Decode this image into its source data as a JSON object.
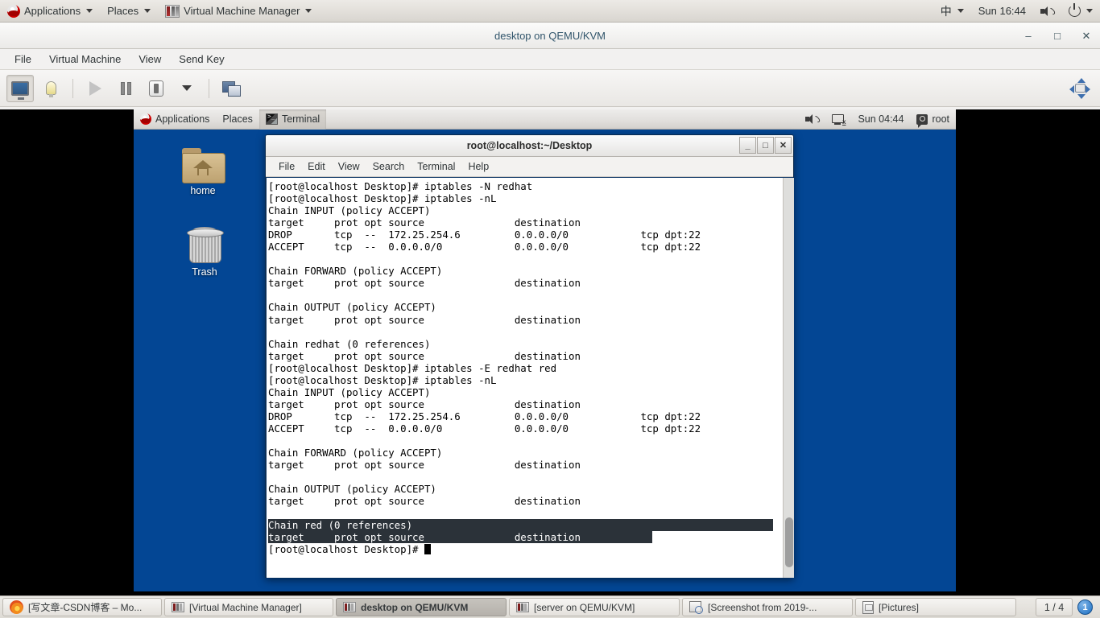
{
  "host_panel": {
    "applications": "Applications",
    "places": "Places",
    "active_app": "Virtual Machine Manager",
    "ime": "中",
    "clock": "Sun 16:44",
    "icons": {
      "redhat": "redhat-logo-icon",
      "volume": "volume-icon",
      "power": "power-icon"
    }
  },
  "vmm_window": {
    "title": "desktop on QEMU/KVM",
    "menus": [
      "File",
      "Virtual Machine",
      "View",
      "Send Key"
    ],
    "window_buttons": {
      "minimize": "–",
      "maximize": "□",
      "close": "✕"
    },
    "toolbar": [
      {
        "name": "show-console",
        "icon": "monitor-icon",
        "active": true
      },
      {
        "name": "show-details",
        "icon": "lightbulb-icon",
        "active": false
      },
      {
        "name": "run",
        "icon": "play-icon",
        "active": false
      },
      {
        "name": "pause",
        "icon": "pause-icon",
        "active": false
      },
      {
        "name": "shutdown",
        "icon": "shutdown-icon",
        "active": false
      },
      {
        "name": "shutdown-options",
        "icon": "chevron-down-icon",
        "active": false
      },
      {
        "name": "snapshots",
        "icon": "screens-icon",
        "active": false
      }
    ],
    "resize_icon": "resize-to-vm-icon"
  },
  "guest": {
    "panel": {
      "applications": "Applications",
      "places": "Places",
      "active_window": "Terminal",
      "clock": "Sun 04:44",
      "user": "root",
      "icons": {
        "redhat": "redhat-logo-icon",
        "volume": "volume-icon",
        "network": "network-disconnected-icon",
        "user": "user-icon"
      }
    },
    "desktop_icons": [
      {
        "label": "home",
        "icon": "home-folder-icon"
      },
      {
        "label": "Trash",
        "icon": "trash-icon"
      }
    ],
    "terminal": {
      "title": "root@localhost:~/Desktop",
      "menus": [
        "File",
        "Edit",
        "View",
        "Search",
        "Terminal",
        "Help"
      ],
      "window_buttons": {
        "minimize": "_",
        "maximize": "□",
        "close": "✕"
      },
      "lines": [
        {
          "text": "[root@localhost Desktop]# iptables -N redhat",
          "hl": 0
        },
        {
          "text": "[root@localhost Desktop]# iptables -nL",
          "hl": 0
        },
        {
          "text": "Chain INPUT (policy ACCEPT)",
          "hl": 0
        },
        {
          "text": "target     prot opt source               destination",
          "hl": 0
        },
        {
          "text": "DROP       tcp  --  172.25.254.6         0.0.0.0/0            tcp dpt:22",
          "hl": 0
        },
        {
          "text": "ACCEPT     tcp  --  0.0.0.0/0            0.0.0.0/0            tcp dpt:22",
          "hl": 0
        },
        {
          "text": "",
          "hl": 0
        },
        {
          "text": "Chain FORWARD (policy ACCEPT)",
          "hl": 0
        },
        {
          "text": "target     prot opt source               destination",
          "hl": 0
        },
        {
          "text": "",
          "hl": 0
        },
        {
          "text": "Chain OUTPUT (policy ACCEPT)",
          "hl": 0
        },
        {
          "text": "target     prot opt source               destination",
          "hl": 0
        },
        {
          "text": "",
          "hl": 0
        },
        {
          "text": "Chain redhat (0 references)",
          "hl": 0
        },
        {
          "text": "target     prot opt source               destination",
          "hl": 0
        },
        {
          "text": "[root@localhost Desktop]# iptables -E redhat red",
          "hl": 0
        },
        {
          "text": "[root@localhost Desktop]# iptables -nL",
          "hl": 0
        },
        {
          "text": "Chain INPUT (policy ACCEPT)",
          "hl": 0
        },
        {
          "text": "target     prot opt source               destination",
          "hl": 0
        },
        {
          "text": "DROP       tcp  --  172.25.254.6         0.0.0.0/0            tcp dpt:22",
          "hl": 0
        },
        {
          "text": "ACCEPT     tcp  --  0.0.0.0/0            0.0.0.0/0            tcp dpt:22",
          "hl": 0
        },
        {
          "text": "",
          "hl": 0
        },
        {
          "text": "Chain FORWARD (policy ACCEPT)",
          "hl": 0
        },
        {
          "text": "target     prot opt source               destination",
          "hl": 0
        },
        {
          "text": "",
          "hl": 0
        },
        {
          "text": "Chain OUTPUT (policy ACCEPT)",
          "hl": 0
        },
        {
          "text": "target     prot opt source               destination",
          "hl": 0
        },
        {
          "text": "",
          "hl": 0
        },
        {
          "text": "Chain red (0 references)",
          "hl": 2
        },
        {
          "text": "target     prot opt source               destination",
          "hl": 1
        },
        {
          "text": "[root@localhost Desktop]# ",
          "hl": 0,
          "cursor": true
        }
      ]
    }
  },
  "taskbar": {
    "items": [
      {
        "label": "[写文章-CSDN博客 – Mo...",
        "icon": "firefox-icon",
        "active": false
      },
      {
        "label": "[Virtual Machine Manager]",
        "icon": "vmm-icon",
        "active": false
      },
      {
        "label": "desktop on QEMU/KVM",
        "icon": "vmm-icon",
        "active": true
      },
      {
        "label": "[server on QEMU/KVM]",
        "icon": "vmm-icon",
        "active": false
      },
      {
        "label": "[Screenshot from 2019-...",
        "icon": "screenshot-icon",
        "active": false
      },
      {
        "label": "[Pictures]",
        "icon": "file-manager-icon",
        "active": false
      }
    ],
    "pager": "1 / 4",
    "notification_count": "1"
  },
  "colors": {
    "desktop_blue": "#034694",
    "terminal_border": "#163d6b",
    "selection_bg": "#2b3239",
    "panel_gray": "#e3e0db"
  }
}
